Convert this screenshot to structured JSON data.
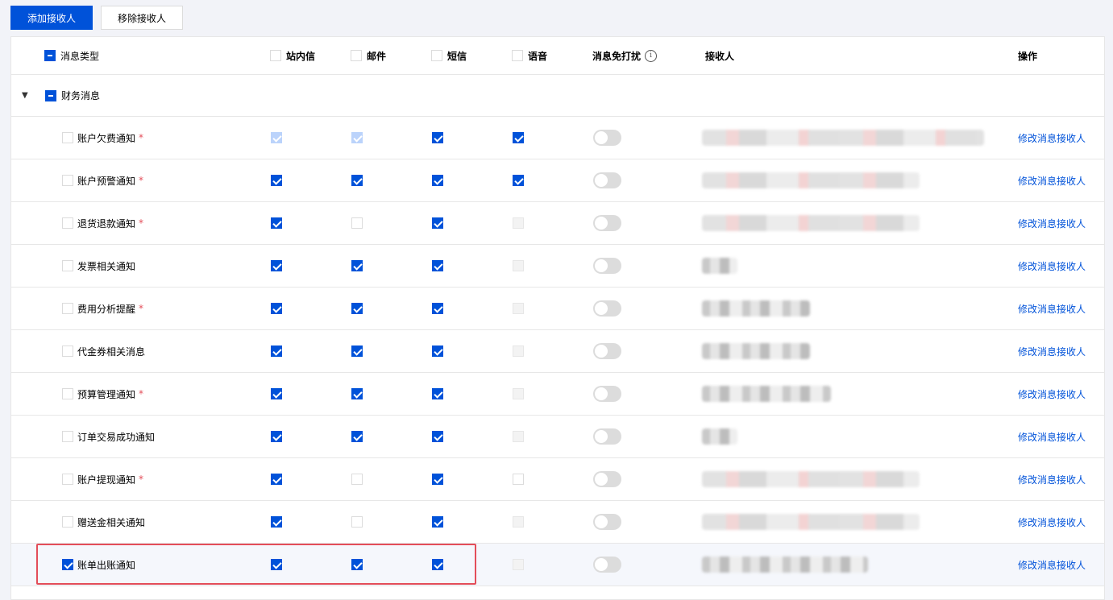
{
  "toolbar": {
    "add_label": "添加接收人",
    "remove_label": "移除接收人"
  },
  "header": {
    "type": "消息类型",
    "inbox": "站内信",
    "email": "邮件",
    "sms": "短信",
    "voice": "语音",
    "dnd": "消息免打扰",
    "dnd_info_icon": "i",
    "recipients": "接收人",
    "action": "操作"
  },
  "group": {
    "label": "财务消息",
    "caret": "▼",
    "expanded": true,
    "checkbox": "indeterminate"
  },
  "required_mark": "*",
  "rows": [
    {
      "name": "账户欠费通知",
      "required": true,
      "selected": false,
      "inbox": "checked-disabled",
      "email": "checked-disabled",
      "sms": "checked",
      "voice": "checked",
      "dnd": false,
      "recipients": "blurred-long",
      "action": "修改消息接收人"
    },
    {
      "name": "账户预警通知",
      "required": true,
      "selected": false,
      "inbox": "checked",
      "email": "checked",
      "sms": "checked",
      "voice": "checked",
      "dnd": false,
      "recipients": "blurred-medium",
      "action": "修改消息接收人"
    },
    {
      "name": "退货退款通知",
      "required": true,
      "selected": false,
      "inbox": "checked",
      "email": "unchecked",
      "sms": "checked",
      "voice": "disabled",
      "dnd": false,
      "recipients": "blurred-medium",
      "action": "修改消息接收人"
    },
    {
      "name": "发票相关通知",
      "required": false,
      "selected": false,
      "inbox": "checked",
      "email": "checked",
      "sms": "checked",
      "voice": "disabled",
      "dnd": false,
      "recipients": "blurred-short",
      "action": "修改消息接收人"
    },
    {
      "name": "费用分析提醒",
      "required": true,
      "selected": false,
      "inbox": "checked",
      "email": "checked",
      "sms": "checked",
      "voice": "disabled",
      "dnd": false,
      "recipients": "blurred-small",
      "action": "修改消息接收人"
    },
    {
      "name": "代金券相关消息",
      "required": false,
      "selected": false,
      "inbox": "checked",
      "email": "checked",
      "sms": "checked",
      "voice": "disabled",
      "dnd": false,
      "recipients": "blurred-small",
      "action": "修改消息接收人"
    },
    {
      "name": "预算管理通知",
      "required": true,
      "selected": false,
      "inbox": "checked",
      "email": "checked",
      "sms": "checked",
      "voice": "disabled",
      "dnd": false,
      "recipients": "blurred-small2",
      "action": "修改消息接收人"
    },
    {
      "name": "订单交易成功通知",
      "required": false,
      "selected": false,
      "inbox": "checked",
      "email": "checked",
      "sms": "checked",
      "voice": "disabled",
      "dnd": false,
      "recipients": "blurred-short",
      "action": "修改消息接收人"
    },
    {
      "name": "账户提现通知",
      "required": true,
      "selected": false,
      "inbox": "checked",
      "email": "unchecked",
      "sms": "checked",
      "voice": "unchecked",
      "dnd": false,
      "recipients": "blurred-medium",
      "action": "修改消息接收人"
    },
    {
      "name": "赠送金相关通知",
      "required": false,
      "selected": false,
      "inbox": "checked",
      "email": "unchecked",
      "sms": "checked",
      "voice": "disabled",
      "dnd": false,
      "recipients": "blurred-medium",
      "action": "修改消息接收人"
    },
    {
      "name": "账单出账通知",
      "required": false,
      "selected": true,
      "inbox": "checked",
      "email": "checked",
      "sms": "checked",
      "voice": "disabled",
      "dnd": false,
      "recipients": "blurred-medium2",
      "action": "修改消息接收人"
    }
  ],
  "colors": {
    "primary": "#0052d9",
    "required": "#e34d59",
    "highlight_border": "#e34d59"
  }
}
